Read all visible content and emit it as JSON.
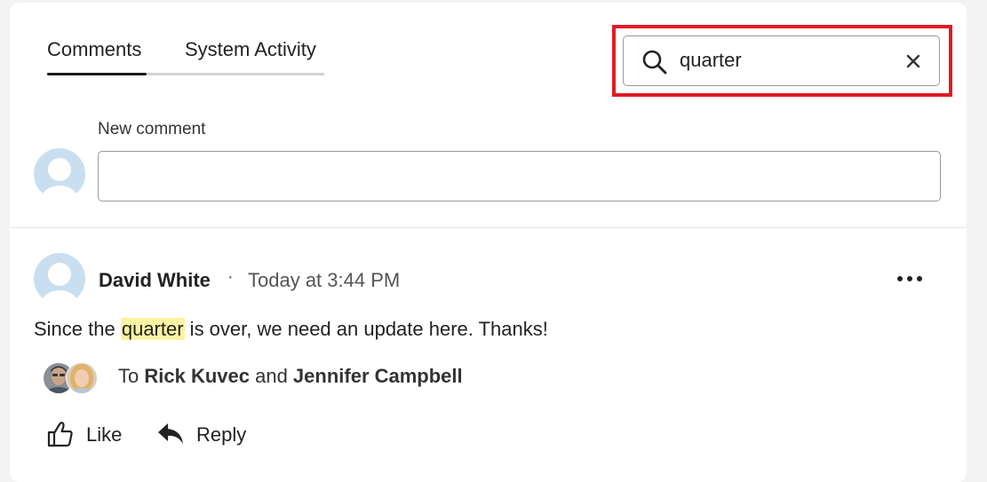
{
  "tabs": [
    {
      "label": "Comments",
      "active": true
    },
    {
      "label": "System Activity",
      "active": false
    }
  ],
  "search": {
    "value": "quarter",
    "icon": "search-icon",
    "clear_icon": "close-icon"
  },
  "new_comment": {
    "label": "New comment",
    "value": ""
  },
  "comment": {
    "author": "David White",
    "separator": "·",
    "timestamp": "Today at 3:44 PM",
    "text_before": "Since the ",
    "text_highlight": "quarter",
    "text_after": " is over, we need an update here. Thanks!",
    "recipients_prefix": "To ",
    "recipient_1": "Rick Kuvec",
    "recipients_joiner": " and ",
    "recipient_2": "Jennifer Campbell",
    "more_icon": "more-options-icon"
  },
  "actions": {
    "like_label": "Like",
    "reply_label": "Reply"
  },
  "colors": {
    "highlight": "#fbf3a2",
    "search_focus_outline": "#e01b24",
    "avatar_placeholder": "#c9dff0"
  }
}
